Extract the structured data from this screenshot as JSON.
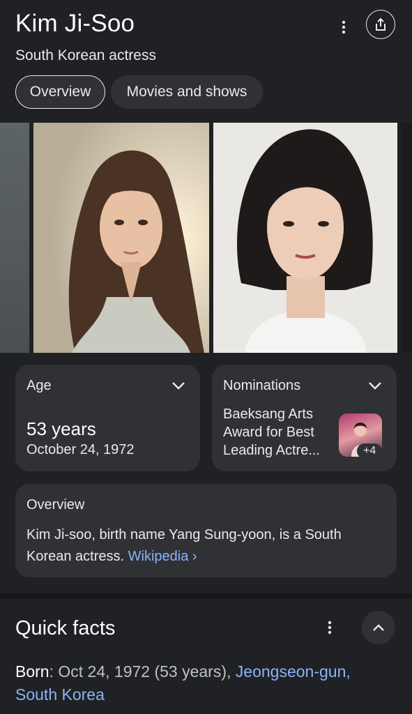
{
  "header": {
    "title": "Kim Ji-Soo",
    "subtitle": "South Korean actress",
    "icons": {
      "menu": "more-vert-icon",
      "share": "share-icon"
    }
  },
  "tabs": [
    {
      "label": "Overview",
      "selected": true
    },
    {
      "label": "Movies and shows",
      "selected": false
    }
  ],
  "cards": {
    "age": {
      "label": "Age",
      "value": "53 years",
      "date": "October 24, 1972"
    },
    "nominations": {
      "label": "Nominations",
      "text": "Baeksang Arts Award for Best Leading Actre...",
      "badge": "+4"
    },
    "overview": {
      "label": "Overview",
      "text": "Kim Ji-soo, birth name Yang Sung-yoon, is a South Korean actress.",
      "link": "Wikipedia ›"
    }
  },
  "quick_facts": {
    "title": "Quick facts",
    "born_label": "Born",
    "born_value": "Oct 24, 1972 (53 years),",
    "born_place": "Jeongseon-gun, South Korea"
  },
  "colors": {
    "background": "#202124",
    "card": "#303134",
    "link": "#8ab4f8",
    "text": "#e8eaed"
  }
}
